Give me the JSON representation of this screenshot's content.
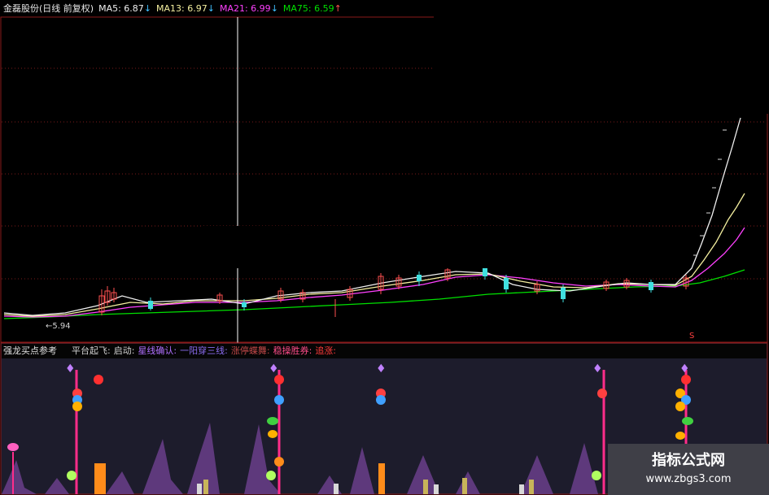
{
  "header": {
    "stock_title": "金磊股份(日线 前复权)",
    "ma5_label": "MA5: 6.87",
    "ma5_arrow": "↓",
    "ma13_label": "MA13: 6.97",
    "ma13_arrow": "↓",
    "ma21_label": "MA21: 6.99",
    "ma21_arrow": "↓",
    "ma75_label": "MA75: 6.59",
    "ma75_arrow": "↑"
  },
  "price_panel": {
    "low_marker": "←5.94",
    "signal_marker": "S"
  },
  "indicator": {
    "name": "强龙买点参考",
    "items": [
      {
        "label": "平台起飞:",
        "color": "#d0d0d0"
      },
      {
        "label": "启动:",
        "color": "#d0d0d0"
      },
      {
        "label": "星线确认:",
        "color": "#b070ff"
      },
      {
        "label": "一阳穿三线:",
        "color": "#8a6cf0"
      },
      {
        "label": "涨停蝶舞:",
        "color": "#c04848"
      },
      {
        "label": "稳操胜券:",
        "color": "#ff4d8a"
      },
      {
        "label": "追涨:",
        "color": "#ff3a3a"
      }
    ]
  },
  "watermark": {
    "line1": "指标公式网",
    "line2": "www.zbgs3.com"
  },
  "colors": {
    "ma5": "#f0f0f0",
    "ma13": "#f5f0a0",
    "ma21": "#ff40ff",
    "ma75": "#00e000",
    "up_candle": "#ff5050",
    "down_candle": "#40e0e0",
    "grid": "#7a1a1a",
    "cursor": "#ffffff",
    "signal_line": "#ff2d8a"
  }
}
